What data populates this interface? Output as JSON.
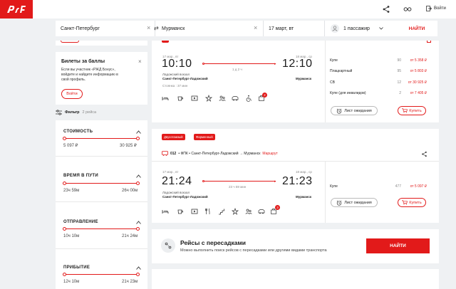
{
  "brand": {
    "logo_text": "РЖД",
    "accent": "#e21a1a"
  },
  "topbar": {
    "login_label": "Войти"
  },
  "search": {
    "from": "Санкт-Петербург",
    "to": "Мурманск",
    "date": "17 март, вт",
    "passengers": "1 пассажир",
    "find_label": "НАЙТИ"
  },
  "sidebar": {
    "bonus": {
      "title": "Билеты за баллы",
      "text1": "Если вы участник «РЖД Бонус»,",
      "text2": "войдите и найдите информацию в",
      "text3": "свой профиль.",
      "login_label": "Войти"
    },
    "filter": {
      "label": "Фильтр",
      "count": "2 рейса"
    },
    "cost": {
      "title": "СТОИМОСТЬ",
      "min": "5 097 ₽",
      "max": "30 925 ₽"
    },
    "travel_time": {
      "title": "ВРЕМЯ В ПУТИ",
      "min": "23ч 59м",
      "max": "26ч 00м"
    },
    "departure": {
      "title": "ОТПРАВЛЕНИЕ",
      "min": "10ч 10м",
      "max": "21ч 24м"
    },
    "arrival": {
      "title": "ПРИБЫТИЕ",
      "min": "12ч 10м",
      "max": "21ч 23м"
    }
  },
  "train1": {
    "dep_date": "17 мар., вт",
    "arr_date": "18 мар., ср",
    "dep_time": "10:10",
    "arr_time": "12:10",
    "duration": "1 д 2 ч",
    "dep_station": "Ладожский вокзал",
    "dep_city": "Санкт-Петербург-Ладожский",
    "arr_city": "Мурманск",
    "stop": "Стоянка : 37 мин",
    "badge_count": "2",
    "wait_label": "Лист ожидания",
    "buy_label": "Купить",
    "prices": [
      {
        "cls": "Купе",
        "seats": "90",
        "price": "от 5 358 ₽"
      },
      {
        "cls": "Плацкартный",
        "seats": "95",
        "price": "от 5 803 ₽"
      },
      {
        "cls": "СВ",
        "seats": "12",
        "price": "от 30 925 ₽"
      },
      {
        "cls": "Купе (для инвалидов)",
        "seats": "2",
        "price": "от 7 405 ₽"
      }
    ]
  },
  "train2": {
    "badge1": "Двухэтажный",
    "badge2": "Фирменный",
    "route_number": "012",
    "route_text": "• ФПК • Санкт-Петербург-Ладожский → Мурманск",
    "route_link": "Маршрут",
    "dep_date": "17 мар., вт",
    "arr_date": "18 мар., ср",
    "dep_time": "21:24",
    "arr_time": "21:23",
    "duration": "23 ч 59 мин",
    "dep_station": "Ладожский вокзал",
    "dep_city": "Санкт-Петербург-Ладожский",
    "arr_city": "Мурманск",
    "badge_count": "3",
    "wait_label": "Лист ожидания",
    "buy_label": "Купить",
    "prices": [
      {
        "cls": "Купе",
        "seats": "477",
        "price": "от 5 097 ₽"
      }
    ]
  },
  "transfers": {
    "title": "Рейсы с пересадками",
    "text": "Можно выполнить поиск рейсов с пересадками или другими видами транспорта",
    "button": "НАЙТИ"
  }
}
